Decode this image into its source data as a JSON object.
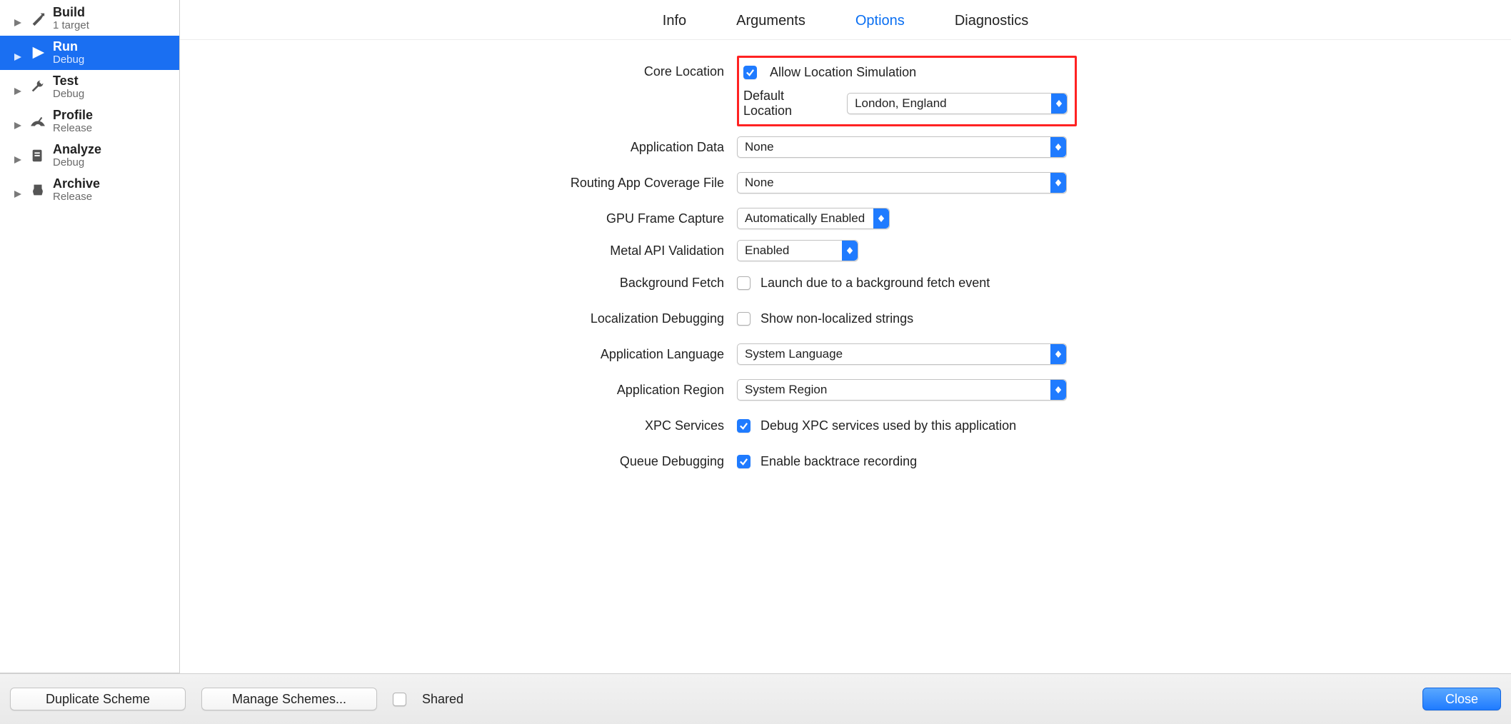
{
  "sidebar": {
    "items": [
      {
        "title": "Build",
        "sub": "1 target"
      },
      {
        "title": "Run",
        "sub": "Debug"
      },
      {
        "title": "Test",
        "sub": "Debug"
      },
      {
        "title": "Profile",
        "sub": "Release"
      },
      {
        "title": "Analyze",
        "sub": "Debug"
      },
      {
        "title": "Archive",
        "sub": "Release"
      }
    ],
    "selected_index": 1
  },
  "tabs": {
    "items": [
      "Info",
      "Arguments",
      "Options",
      "Diagnostics"
    ],
    "active_index": 2
  },
  "form": {
    "core_location_label": "Core Location",
    "allow_location_simulation": "Allow Location Simulation",
    "default_location_label": "Default Location",
    "default_location_value": "London, England",
    "application_data_label": "Application Data",
    "application_data_value": "None",
    "routing_file_label": "Routing App Coverage File",
    "routing_file_value": "None",
    "gpu_frame_capture_label": "GPU Frame Capture",
    "gpu_frame_capture_value": "Automatically Enabled",
    "metal_api_validation_label": "Metal API Validation",
    "metal_api_validation_value": "Enabled",
    "background_fetch_label": "Background Fetch",
    "background_fetch_check": "Launch due to a background fetch event",
    "localization_debugging_label": "Localization Debugging",
    "localization_debugging_check": "Show non-localized strings",
    "application_language_label": "Application Language",
    "application_language_value": "System Language",
    "application_region_label": "Application Region",
    "application_region_value": "System Region",
    "xpc_services_label": "XPC Services",
    "xpc_services_check": "Debug XPC services used by this application",
    "queue_debugging_label": "Queue Debugging",
    "queue_debugging_check": "Enable backtrace recording"
  },
  "footer": {
    "duplicate": "Duplicate Scheme",
    "manage": "Manage Schemes...",
    "shared": "Shared",
    "close": "Close"
  },
  "colors": {
    "accent": "#1f7bff",
    "highlight": "#f22"
  }
}
